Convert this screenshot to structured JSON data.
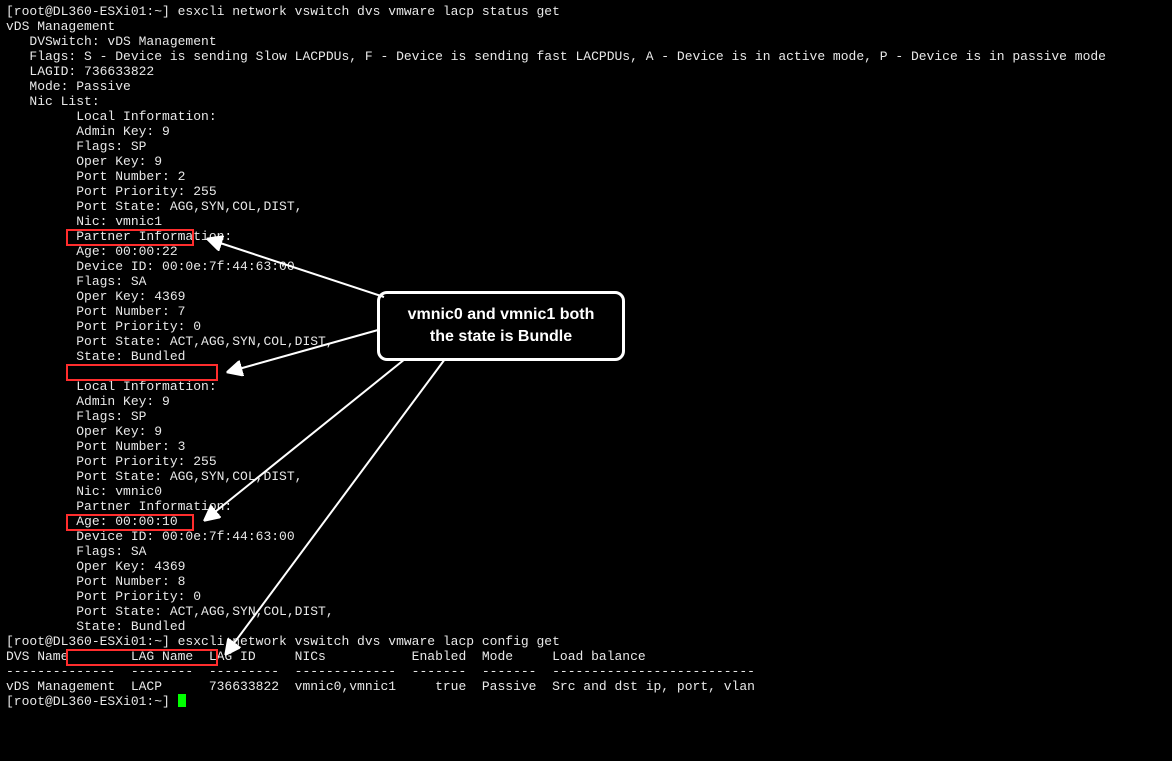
{
  "prompt1": "[root@DL360-ESXi01:~] esxcli network vswitch dvs vmware lacp status get",
  "section_title": "vDS Management",
  "k_dvswitch": "   DVSwitch: vDS Management",
  "k_flags": "   Flags: S - Device is sending Slow LACPDUs, F - Device is sending fast LACPDUs, A - Device is in active mode, P - Device is in passive mode",
  "k_lagid": "   LAGID: 736633822",
  "k_mode": "   Mode: Passive",
  "k_niclist": "   Nic List:",
  "nic1": {
    "local": "         Local Information:",
    "adminkey": "         Admin Key: 9",
    "flags": "         Flags: SP",
    "operkey": "         Oper Key: 9",
    "portnum": "         Port Number: 2",
    "portprio": "         Port Priority: 255",
    "portstate": "         Port State: AGG,SYN,COL,DIST,",
    "nic": "         Nic: vmnic1",
    "partner": "         Partner Information:",
    "age": "         Age: 00:00:22",
    "devid": "         Device ID: 00:0e:7f:44:63:00",
    "pflags": "         Flags: SA",
    "poperkey": "         Oper Key: 4369",
    "pportnum": "         Port Number: 7",
    "pportprio": "         Port Priority: 0",
    "pportstate": "         Port State: ACT,AGG,SYN,COL,DIST,",
    "state": "         State: Bundled"
  },
  "nic0": {
    "local": "         Local Information:",
    "adminkey": "         Admin Key: 9",
    "flags": "         Flags: SP",
    "operkey": "         Oper Key: 9",
    "portnum": "         Port Number: 3",
    "portprio": "         Port Priority: 255",
    "portstate": "         Port State: AGG,SYN,COL,DIST,",
    "nic": "         Nic: vmnic0",
    "partner": "         Partner Information:",
    "age": "         Age: 00:00:10",
    "devid": "         Device ID: 00:0e:7f:44:63:00",
    "pflags": "         Flags: SA",
    "poperkey": "         Oper Key: 4369",
    "pportnum": "         Port Number: 8",
    "pportprio": "         Port Priority: 0",
    "pportstate": "         Port State: ACT,AGG,SYN,COL,DIST,",
    "state": "         State: Bundled"
  },
  "prompt2": "[root@DL360-ESXi01:~] esxcli network vswitch dvs vmware lacp config get",
  "table": {
    "header": "DVS Name        LAG Name  LAG ID     NICs           Enabled  Mode     Load balance",
    "rule": "--------------  --------  ---------  -------------  -------  -------  --------------------------",
    "row": "vDS Management  LACP      736633822  vmnic0,vmnic1     true  Passive  Src and dst ip, port, vlan"
  },
  "prompt3": "[root@DL360-ESXi01:~] ",
  "callout_line1": "vmnic0 and vmnic1 both",
  "callout_line2": "the state is Bundle"
}
